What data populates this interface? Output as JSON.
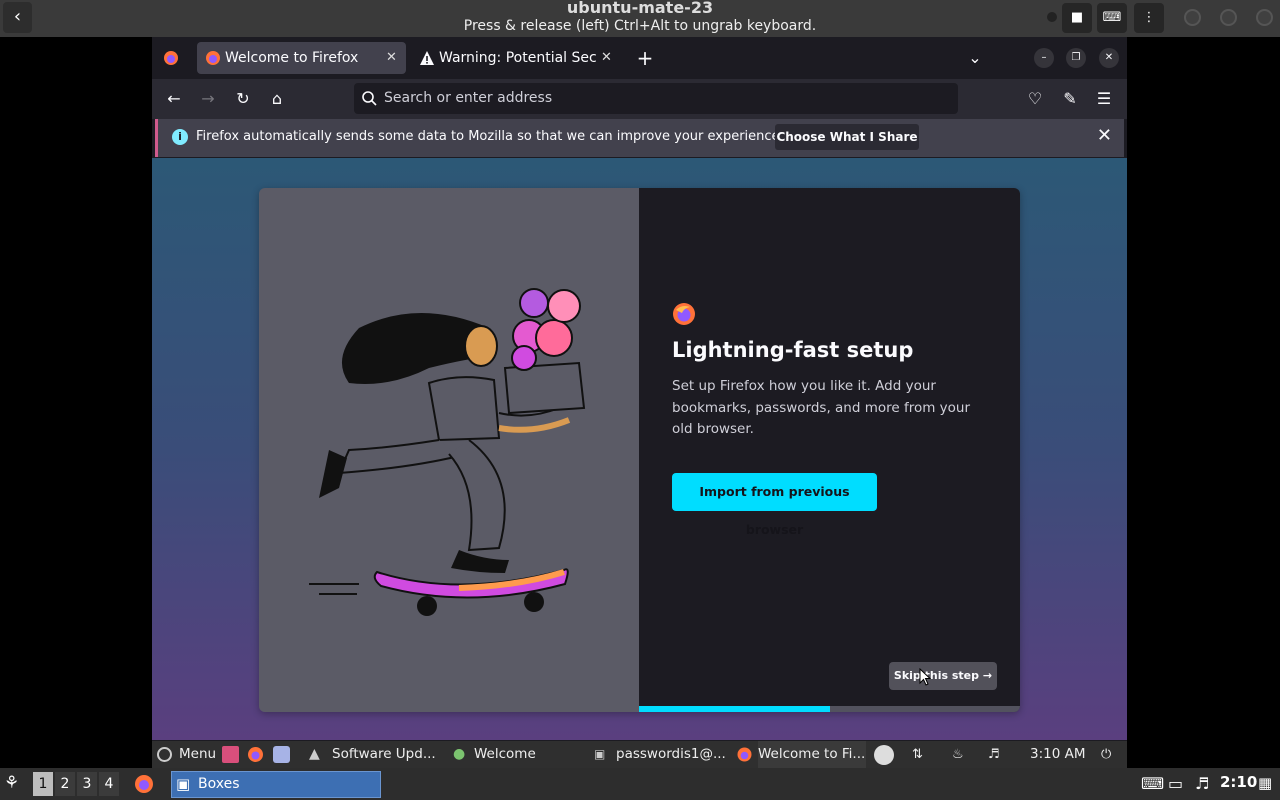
{
  "host": {
    "title": "ubuntu-mate-23",
    "subtitle": "Press & release (left) Ctrl+Alt to ungrab keyboard.",
    "back_icon": "arrow-left-icon",
    "buttons": [
      "stop-icon",
      "keyboard-icon",
      "more-icon"
    ]
  },
  "browser": {
    "tabs": [
      {
        "label": "Welcome to Firefox",
        "icon": "firefox-icon",
        "active": true
      },
      {
        "label": "Warning: Potential Secur",
        "icon": "warning-icon",
        "active": false
      }
    ],
    "new_tab": "+",
    "search_placeholder": "Search or enter address",
    "accent": "#00ddff"
  },
  "notice": {
    "message": "Firefox automatically sends some data to Mozilla so that we can improve your experience.",
    "button_label": "Choose What I Share"
  },
  "onboarding": {
    "title": "Lightning-fast setup",
    "description": "Set up Firefox how you like it. Add your bookmarks, passwords, and more from your old browser.",
    "import_label": "Import from previous browser",
    "skip_label": "Skip this step →",
    "progress_fraction": 0.5
  },
  "guest_panel": {
    "menu_label": "Menu",
    "tasks": [
      "Software Upd...",
      "Welcome",
      "passwordis1@...",
      "Welcome to Fi..."
    ],
    "clock": "3:10 AM"
  },
  "host_panel": {
    "workspaces": [
      "1",
      "2",
      "3",
      "4"
    ],
    "active_workspace": "1",
    "task_label": "Boxes",
    "clock": "2:10"
  }
}
